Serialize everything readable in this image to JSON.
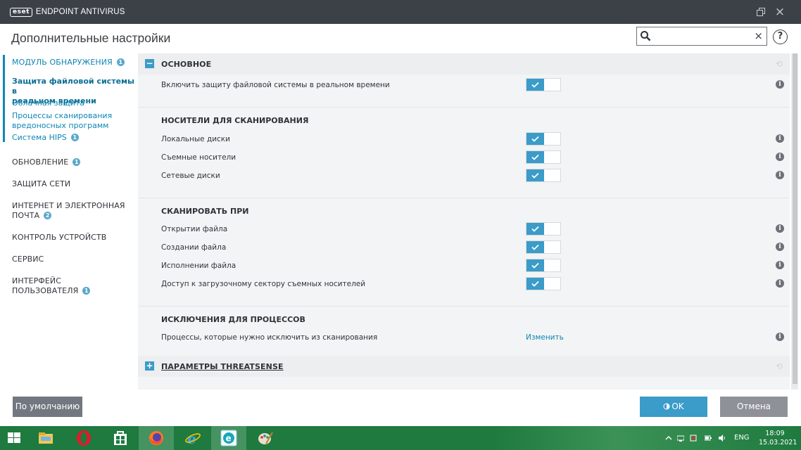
{
  "window": {
    "logo_box": "eset",
    "logo_text": "ENDPOINT ANTIVIRUS",
    "restore_icon": "restore-icon",
    "close_icon": "close-icon"
  },
  "header": {
    "title": "Дополнительные настройки",
    "search_value": "",
    "clear_icon": "×",
    "help": "?"
  },
  "sidebar": {
    "items": [
      {
        "label": "МОДУЛЬ ОБНАРУЖЕНИЯ",
        "badge": "1"
      },
      {
        "label": "ОБНОВЛЕНИЕ",
        "badge": "1"
      },
      {
        "label": "ЗАЩИТА СЕТИ"
      },
      {
        "label": "ИНТЕРНЕТ И ЭЛЕКТРОННАЯ",
        "label2": "ПОЧТА",
        "badge": "2"
      },
      {
        "label": "КОНТРОЛЬ УСТРОЙСТВ"
      },
      {
        "label": "СЕРВИС"
      },
      {
        "label": "ИНТЕРФЕЙС",
        "label2": "ПОЛЬЗОВАТЕЛЯ",
        "badge": "1"
      }
    ],
    "subitems": [
      {
        "label": "Защита файловой системы в",
        "label2": "реальном времени"
      },
      {
        "label": "Облачная защита"
      },
      {
        "label": "Процессы сканирования",
        "label2": "вредоносных программ"
      },
      {
        "label": "Система HIPS",
        "badge": "1"
      }
    ]
  },
  "content": {
    "main_section": {
      "toggle": "−",
      "title": "ОСНОВНОЕ"
    },
    "enable_row": {
      "label": "Включить защиту файловой системы в реальном времени",
      "enabled": true
    },
    "media": {
      "title": "НОСИТЕЛИ ДЛЯ СКАНИРОВАНИЯ",
      "rows": [
        {
          "label": "Локальные диски",
          "enabled": true
        },
        {
          "label": "Съемные носители",
          "enabled": true
        },
        {
          "label": "Сетевые диски",
          "enabled": true
        }
      ]
    },
    "scan_on": {
      "title": "СКАНИРОВАТЬ ПРИ",
      "rows": [
        {
          "label": "Открытии файла",
          "enabled": true
        },
        {
          "label": "Создании файла",
          "enabled": true
        },
        {
          "label": "Исполнении файла",
          "enabled": true
        },
        {
          "label": "Доступ к загрузочному сектору съемных носителей",
          "enabled": true
        }
      ]
    },
    "exclusions": {
      "title": "ИСКЛЮЧЕНИЯ ДЛЯ ПРОЦЕССОВ",
      "row_label": "Процессы, которые нужно исключить из сканирования",
      "link": "Изменить"
    },
    "threatsense_section": {
      "toggle": "+",
      "title": "ПАРАМЕТРЫ THREATSENSE"
    },
    "info_glyph": "i"
  },
  "footer": {
    "default_label": "По умолчанию",
    "ok_label": "OK",
    "cancel_label": "Отмена"
  },
  "taskbar": {
    "apps": [
      "file-explorer-icon",
      "opera-icon",
      "store-icon",
      "firefox-icon",
      "internet-explorer-icon",
      "eset-icon",
      "paint-icon"
    ],
    "lang": "ENG",
    "time": "18:09",
    "date": "15.03.2021"
  },
  "colors": {
    "accent": "#3b9bc9",
    "titlebar": "#3c4047",
    "taskbar": "#1e7a3f"
  }
}
